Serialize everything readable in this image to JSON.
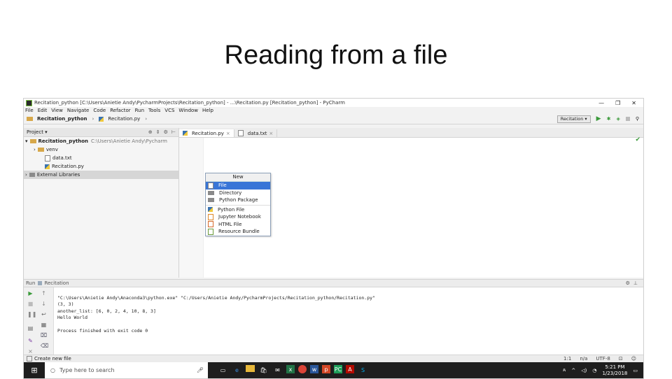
{
  "slide": {
    "title": "Reading from a file"
  },
  "window": {
    "title": "Recitation_python [C:\\Users\\Anietie Andy\\PycharmProjects\\Recitation_python] - ...\\Recitation.py [Recitation_python] - PyCharm",
    "controls": [
      "—",
      "❐",
      "✕"
    ]
  },
  "menu": [
    "File",
    "Edit",
    "View",
    "Navigate",
    "Code",
    "Refactor",
    "Run",
    "Tools",
    "VCS",
    "Window",
    "Help"
  ],
  "breadcrumb": {
    "project": "Recitation_python",
    "file": "Recitation.py"
  },
  "run_config": {
    "selected": "Recitation"
  },
  "project_panel": {
    "header": "Project",
    "tree": [
      {
        "label": "Recitation_python",
        "path": "C:\\Users\\Anietie Andy\\Pycharm"
      },
      {
        "label": "venv"
      },
      {
        "label": "data.txt"
      },
      {
        "label": "Recitation.py"
      },
      {
        "label": "External Libraries"
      }
    ]
  },
  "editor_tabs": [
    {
      "label": "Recitation.py"
    },
    {
      "label": "data.txt"
    }
  ],
  "new_popup": {
    "header": "New",
    "items": [
      "File",
      "Directory",
      "Python Package",
      "Python File",
      "Jupyter Notebook",
      "HTML File",
      "Resource Bundle"
    ]
  },
  "run_panel": {
    "label": "Run",
    "config": "Recitation",
    "console": [
      "\"C:\\Users\\Anietie Andy\\Anaconda3\\python.exe\" \"C:/Users/Anietie Andy/PycharmProjects/Recitation_python/Recitation.py\"",
      "(3, 3)",
      "another_list: [6, 0, 2, 4, 10, 8, 3]",
      "Hello World",
      "",
      "Process finished with exit code 0"
    ]
  },
  "status_bar": {
    "left": "Create new file",
    "position": "1:1",
    "na": "n/a",
    "encoding": "UTF-8"
  },
  "taskbar": {
    "search_placeholder": "Type here to search",
    "time": "5:21 PM",
    "date": "1/23/2018"
  }
}
